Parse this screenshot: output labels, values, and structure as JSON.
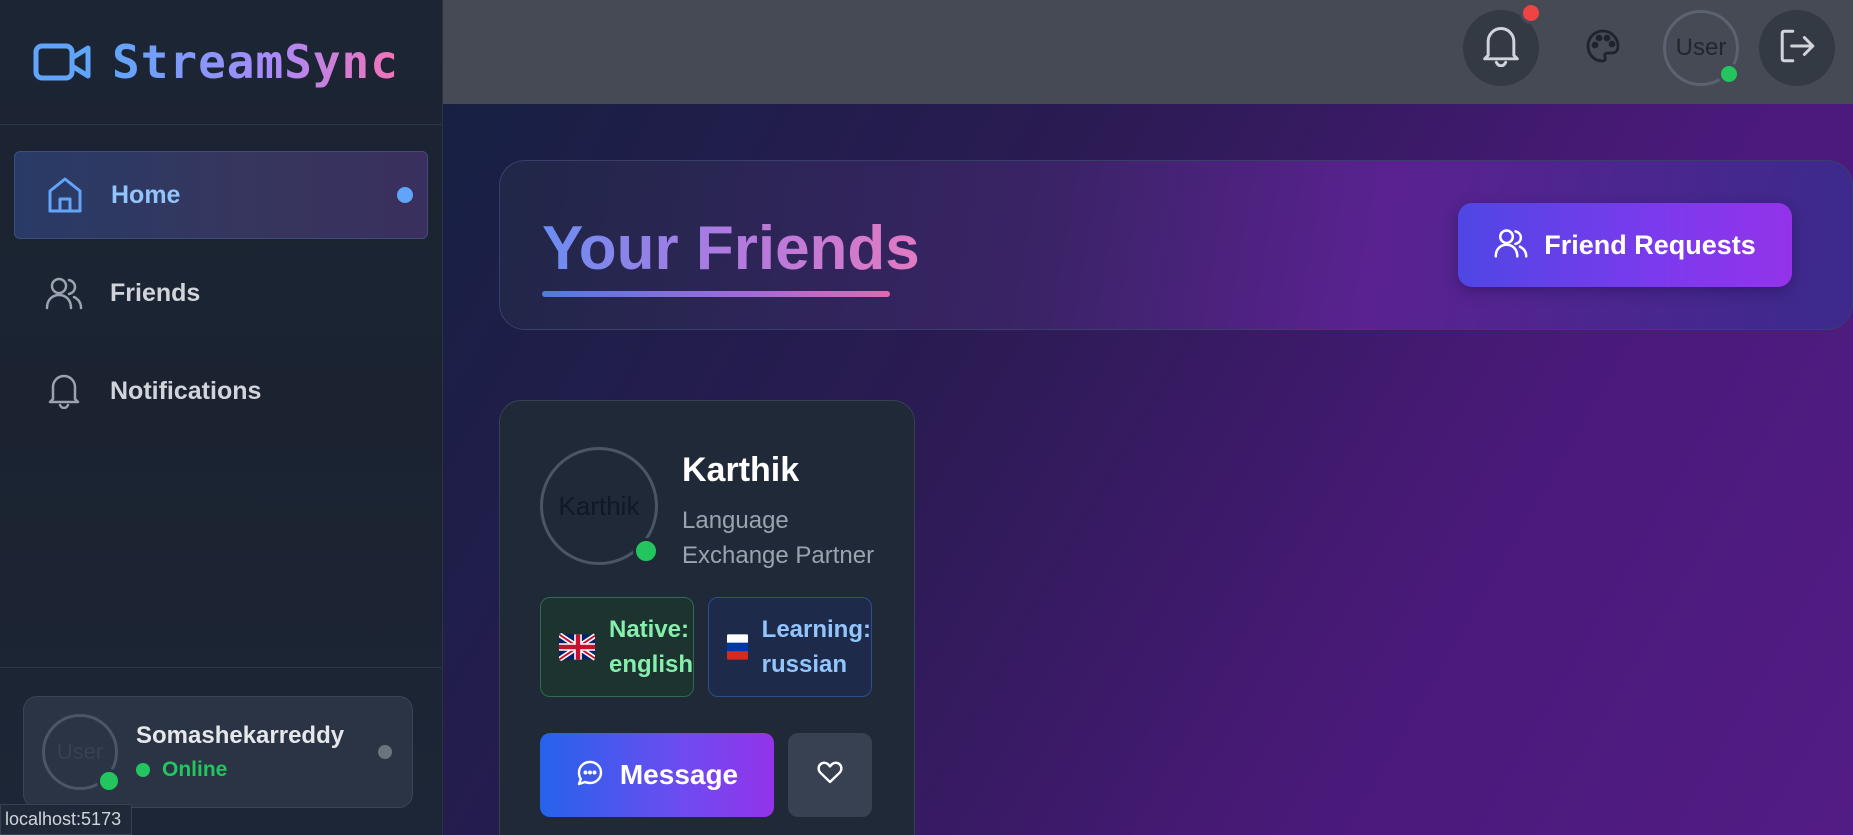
{
  "brand": {
    "name": "StreamSync",
    "icon": "video-camera-icon"
  },
  "sidebar": {
    "items": [
      {
        "label": "Home",
        "icon": "home-icon",
        "active": true
      },
      {
        "label": "Friends",
        "icon": "users-icon",
        "active": false
      },
      {
        "label": "Notifications",
        "icon": "bell-icon",
        "active": false
      }
    ]
  },
  "current_user": {
    "name": "Somashekarreddy",
    "status": "Online",
    "avatar_alt": "User"
  },
  "topbar": {
    "notifications_icon": "bell-icon",
    "theme_icon": "palette-icon",
    "avatar_alt": "User",
    "logout_icon": "logout-icon"
  },
  "page": {
    "title": "Your Friends",
    "friend_requests_label": "Friend Requests"
  },
  "friends": [
    {
      "name": "Karthik",
      "subtitle": "Language Exchange Partner",
      "avatar_alt": "Karthik",
      "native_label": "Native:",
      "native_language": "english",
      "learning_label": "Learning:",
      "learning_language": "russian",
      "message_label": "Message"
    }
  ],
  "statusbar": {
    "url": "localhost:5173"
  },
  "colors": {
    "accent_blue": "#60a5fa",
    "online_green": "#22c55e",
    "badge_red": "#ef4444",
    "purple": "#9333ea"
  }
}
